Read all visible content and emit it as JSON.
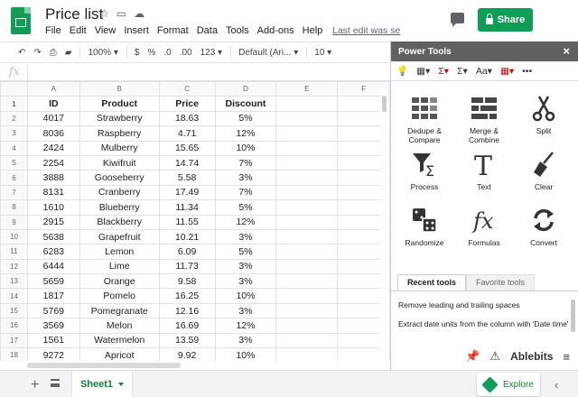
{
  "header": {
    "title": "Price list",
    "menu": [
      "File",
      "Edit",
      "View",
      "Insert",
      "Format",
      "Data",
      "Tools",
      "Add-ons",
      "Help"
    ],
    "last_edit": "Last edit was se",
    "share_label": "Share"
  },
  "toolbar": {
    "zoom": "100%",
    "currency": "$",
    "percent": "%",
    "dec_dec": ".0",
    "inc_dec": ".00",
    "more_formats": "123",
    "font": "Default (Ari...",
    "font_size": "10"
  },
  "formula_bar": {
    "fx_label": "fx",
    "value": ""
  },
  "sheet": {
    "columns": [
      "A",
      "B",
      "C",
      "D",
      "E",
      "F"
    ],
    "rows": [
      [
        "ID",
        "Product",
        "Price",
        "Discount"
      ],
      [
        "4017",
        "Strawberry",
        "18.63",
        "5%"
      ],
      [
        "8036",
        "Raspberry",
        "4.71",
        "12%"
      ],
      [
        "2424",
        "Mulberry",
        "15.65",
        "10%"
      ],
      [
        "2254",
        "Kiwifruit",
        "14.74",
        "7%"
      ],
      [
        "3888",
        "Gooseberry",
        "5.58",
        "3%"
      ],
      [
        "8131",
        "Cranberry",
        "17.49",
        "7%"
      ],
      [
        "1610",
        "Blueberry",
        "11.34",
        "5%"
      ],
      [
        "2915",
        "Blackberry",
        "11.55",
        "12%"
      ],
      [
        "5638",
        "Grapefruit",
        "10.21",
        "3%"
      ],
      [
        "6283",
        "Lemon",
        "6.09",
        "5%"
      ],
      [
        "6444",
        "Lime",
        "11.73",
        "3%"
      ],
      [
        "5659",
        "Orange",
        "9.58",
        "3%"
      ],
      [
        "1817",
        "Pomelo",
        "16.25",
        "10%"
      ],
      [
        "5769",
        "Pomegranate",
        "12.16",
        "3%"
      ],
      [
        "3569",
        "Melon",
        "16.69",
        "12%"
      ],
      [
        "1561",
        "Watermelon",
        "13.59",
        "3%"
      ],
      [
        "9272",
        "Apricot",
        "9.92",
        "10%"
      ]
    ]
  },
  "sheet_tab": "Sheet1",
  "explore_label": "Explore",
  "panel": {
    "title": "Power Tools",
    "close": "×",
    "tools": [
      {
        "label": "Dedupe & Compare",
        "icon": "dedupe-icon"
      },
      {
        "label": "Merge & Combine",
        "icon": "merge-icon"
      },
      {
        "label": "Split",
        "icon": "scissors-icon"
      },
      {
        "label": "Process",
        "icon": "process-icon"
      },
      {
        "label": "Text",
        "icon": "text-icon"
      },
      {
        "label": "Clear",
        "icon": "broom-icon"
      },
      {
        "label": "Randomize",
        "icon": "dice-icon"
      },
      {
        "label": "Formulas",
        "icon": "fx-icon"
      },
      {
        "label": "Convert",
        "icon": "convert-icon"
      }
    ],
    "tabs": [
      "Recent tools",
      "Favorite tools"
    ],
    "recent": [
      "Remove leading and trailing spaces",
      "Extract date units from the column with 'Date time'"
    ],
    "brand": "Ablebits"
  }
}
